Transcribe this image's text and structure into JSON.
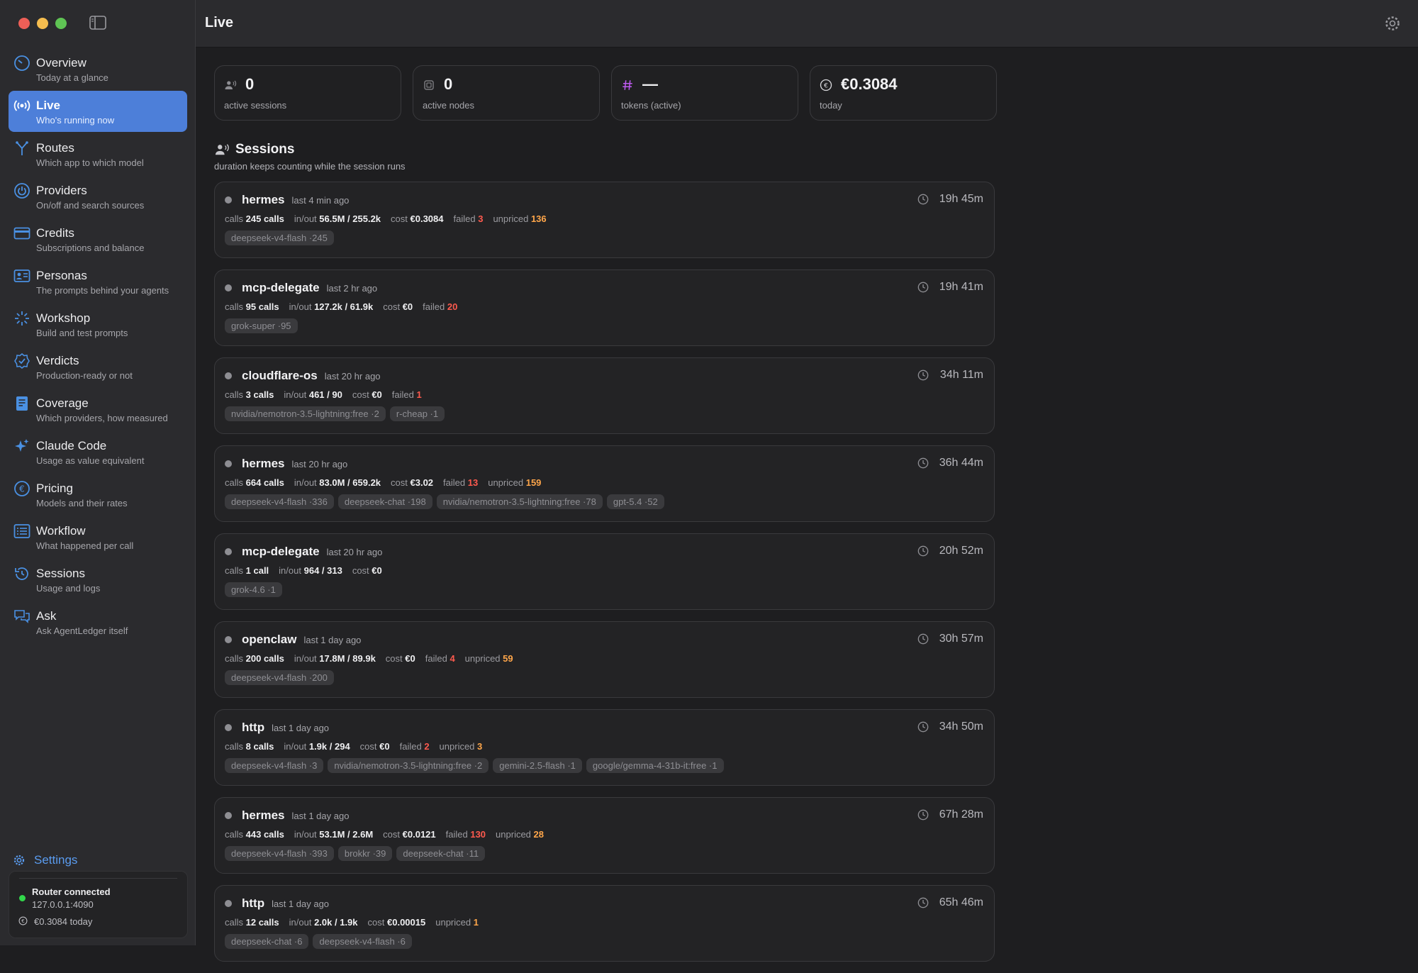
{
  "header": {
    "title": "Live"
  },
  "sidebar": {
    "items": [
      {
        "title": "Overview",
        "subtitle": "Today at a glance",
        "icon": "gauge-icon"
      },
      {
        "title": "Live",
        "subtitle": "Who's running now",
        "icon": "broadcast-icon"
      },
      {
        "title": "Routes",
        "subtitle": "Which app to which model",
        "icon": "routes-icon"
      },
      {
        "title": "Providers",
        "subtitle": "On/off and search sources",
        "icon": "power-icon"
      },
      {
        "title": "Credits",
        "subtitle": "Subscriptions and balance",
        "icon": "credit-card-icon"
      },
      {
        "title": "Personas",
        "subtitle": "The prompts behind your agents",
        "icon": "person-card-icon"
      },
      {
        "title": "Workshop",
        "subtitle": "Build and test prompts",
        "icon": "sparkle-burst-icon"
      },
      {
        "title": "Verdicts",
        "subtitle": "Production-ready or not",
        "icon": "checkmark-seal-icon"
      },
      {
        "title": "Coverage",
        "subtitle": "Which providers, how measured",
        "icon": "document-icon"
      },
      {
        "title": "Claude Code",
        "subtitle": "Usage as value equivalent",
        "icon": "sparkles-icon"
      },
      {
        "title": "Pricing",
        "subtitle": "Models and their rates",
        "icon": "euro-circle-icon"
      },
      {
        "title": "Workflow",
        "subtitle": "What happened per call",
        "icon": "list-icon"
      },
      {
        "title": "Sessions",
        "subtitle": "Usage and logs",
        "icon": "history-icon"
      },
      {
        "title": "Ask",
        "subtitle": "Ask AgentLedger itself",
        "icon": "chat-bubbles-icon"
      }
    ],
    "settings_label": "Settings",
    "status": {
      "label": "Router connected",
      "address": "127.0.0.1:4090",
      "cost_today": "€0.3084 today"
    }
  },
  "stats": [
    {
      "value": "0",
      "label": "active sessions",
      "icon": "people-icon"
    },
    {
      "value": "0",
      "label": "active nodes",
      "icon": "chip-icon"
    },
    {
      "value": "—",
      "label": "tokens (active)",
      "icon": "hash-icon"
    },
    {
      "value": "€0.3084",
      "label": "today",
      "icon": "euro-circle-icon"
    }
  ],
  "section": {
    "title": "Sessions",
    "subtitle": "duration keeps counting while the session runs"
  },
  "metric_labels": {
    "calls": "calls",
    "inout": "in/out",
    "cost": "cost",
    "failed": "failed",
    "unpriced": "unpriced"
  },
  "sessions": [
    {
      "name": "hermes",
      "last": "last 4 min ago",
      "duration": "19h 45m",
      "calls": "245 calls",
      "inout": "56.5M / 255.2k",
      "cost": "€0.3084",
      "failed": "3",
      "unpriced": "136",
      "tags": [
        "deepseek-v4-flash ·245"
      ]
    },
    {
      "name": "mcp-delegate",
      "last": "last 2 hr ago",
      "duration": "19h 41m",
      "calls": "95 calls",
      "inout": "127.2k / 61.9k",
      "cost": "€0",
      "failed": "20",
      "unpriced": null,
      "tags": [
        "grok-super ·95"
      ]
    },
    {
      "name": "cloudflare-os",
      "last": "last 20 hr ago",
      "duration": "34h 11m",
      "calls": "3 calls",
      "inout": "461 / 90",
      "cost": "€0",
      "failed": "1",
      "unpriced": null,
      "tags": [
        "nvidia/nemotron-3.5-lightning:free ·2",
        "r-cheap ·1"
      ]
    },
    {
      "name": "hermes",
      "last": "last 20 hr ago",
      "duration": "36h 44m",
      "calls": "664 calls",
      "inout": "83.0M / 659.2k",
      "cost": "€3.02",
      "failed": "13",
      "unpriced": "159",
      "tags": [
        "deepseek-v4-flash ·336",
        "deepseek-chat ·198",
        "nvidia/nemotron-3.5-lightning:free ·78",
        "gpt-5.4 ·52"
      ]
    },
    {
      "name": "mcp-delegate",
      "last": "last 20 hr ago",
      "duration": "20h 52m",
      "calls": "1 call",
      "inout": "964 / 313",
      "cost": "€0",
      "failed": null,
      "unpriced": null,
      "tags": [
        "grok-4.6 ·1"
      ]
    },
    {
      "name": "openclaw",
      "last": "last 1 day ago",
      "duration": "30h 57m",
      "calls": "200 calls",
      "inout": "17.8M / 89.9k",
      "cost": "€0",
      "failed": "4",
      "unpriced": "59",
      "tags": [
        "deepseek-v4-flash ·200"
      ]
    },
    {
      "name": "http",
      "last": "last 1 day ago",
      "duration": "34h 50m",
      "calls": "8 calls",
      "inout": "1.9k / 294",
      "cost": "€0",
      "failed": "2",
      "unpriced": "3",
      "tags": [
        "deepseek-v4-flash ·3",
        "nvidia/nemotron-3.5-lightning:free ·2",
        "gemini-2.5-flash ·1",
        "google/gemma-4-31b-it:free ·1"
      ]
    },
    {
      "name": "hermes",
      "last": "last 1 day ago",
      "duration": "67h 28m",
      "calls": "443 calls",
      "inout": "53.1M / 2.6M",
      "cost": "€0.0121",
      "failed": "130",
      "unpriced": "28",
      "tags": [
        "deepseek-v4-flash ·393",
        "brokkr ·39",
        "deepseek-chat ·11"
      ]
    },
    {
      "name": "http",
      "last": "last 1 day ago",
      "duration": "65h 46m",
      "calls": "12 calls",
      "inout": "2.0k / 1.9k",
      "cost": "€0.00015",
      "failed": null,
      "unpriced": "1",
      "tags": [
        "deepseek-chat ·6",
        "deepseek-v4-flash ·6"
      ]
    }
  ],
  "colors": {
    "accent": "#4d7fd9",
    "failed": "#ff5a4e",
    "unpriced": "#ffa64a",
    "connected": "#32d74b",
    "link": "#5a9cf0"
  }
}
